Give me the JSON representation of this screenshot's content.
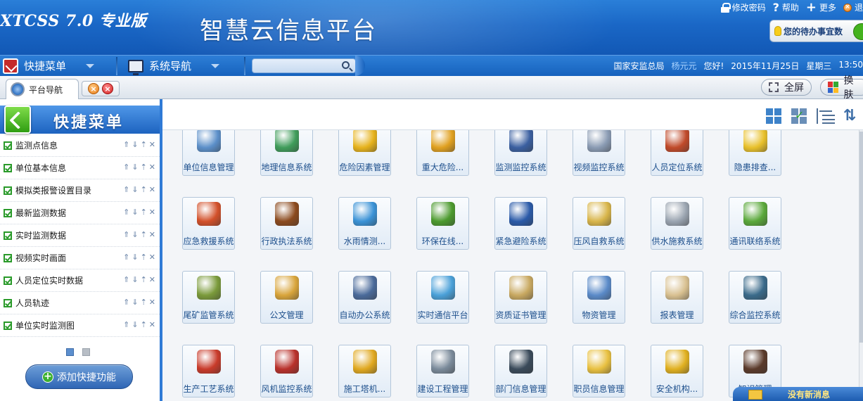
{
  "header": {
    "app_title": "XTCSS 7.0 专业版",
    "platform_title": "智慧云信息平台",
    "links": {
      "change_password": "修改密码",
      "help": "帮助",
      "more": "更多",
      "exit": "退"
    },
    "todo": "您的待办事宜数"
  },
  "navbar": {
    "quick_menu": "快捷菜单",
    "system_nav": "系统导航",
    "search_placeholder": "",
    "org": "国家安监总局",
    "user": "杨元元",
    "greeting": "您好!",
    "date": "2015年11月25日",
    "weekday": "星期三",
    "time": "13:50"
  },
  "tabbar": {
    "active_tab": "平台导航",
    "fullscreen": "全屏",
    "skin": "换肤"
  },
  "sidebar": {
    "title": "快捷菜单",
    "items": [
      {
        "label": "监测点信息"
      },
      {
        "label": "单位基本信息"
      },
      {
        "label": "模拟类报警设置目录"
      },
      {
        "label": "最新监测数据"
      },
      {
        "label": "实时监测数据"
      },
      {
        "label": "视频实时画面"
      },
      {
        "label": "人员定位实时数据"
      },
      {
        "label": "人员轨迹"
      },
      {
        "label": "单位实时监测图"
      }
    ],
    "add_label": "添加快捷功能"
  },
  "tiles": [
    {
      "label": "单位信息管理",
      "color": "#5b8fc9"
    },
    {
      "label": "地理信息系统",
      "color": "#3f9c5a"
    },
    {
      "label": "危险因素管理",
      "color": "#e6b21c"
    },
    {
      "label": "重大危险...",
      "color": "#e0a020"
    },
    {
      "label": "监测监控系统",
      "color": "#3a5fa0"
    },
    {
      "label": "视频监控系统",
      "color": "#8a9bb3"
    },
    {
      "label": "人员定位系统",
      "color": "#c04a2a"
    },
    {
      "label": "隐患排查...",
      "color": "#e8c02a"
    },
    {
      "label": "应急救援系统",
      "color": "#d2502a"
    },
    {
      "label": "行政执法系统",
      "color": "#8b4a1e"
    },
    {
      "label": "水雨情测...",
      "color": "#3a92d6"
    },
    {
      "label": "环保在线...",
      "color": "#4c9a2e"
    },
    {
      "label": "紧急避险系统",
      "color": "#2a5aa8"
    },
    {
      "label": "压风自救系统",
      "color": "#d8b54a"
    },
    {
      "label": "供水施救系统",
      "color": "#9aa4b0"
    },
    {
      "label": "通讯联络系统",
      "color": "#5aa83a"
    },
    {
      "label": "尾矿监管系统",
      "color": "#7a9a3a"
    },
    {
      "label": "公文管理",
      "color": "#d8a43a"
    },
    {
      "label": "自动办公系统",
      "color": "#4a6a9a"
    },
    {
      "label": "实时通信平台",
      "color": "#4aa0d8"
    },
    {
      "label": "资质证书管理",
      "color": "#c8a860"
    },
    {
      "label": "物资管理",
      "color": "#5a8ac8"
    },
    {
      "label": "报表管理",
      "color": "#d8c090"
    },
    {
      "label": "综合监控系统",
      "color": "#3a6a8a"
    },
    {
      "label": "生产工艺系统",
      "color": "#c83a2a"
    },
    {
      "label": "风机监控系统",
      "color": "#b8302a"
    },
    {
      "label": "施工塔机...",
      "color": "#e0a820"
    },
    {
      "label": "建设工程管理",
      "color": "#7a8a9a"
    },
    {
      "label": "部门信息管理",
      "color": "#3a4a5a"
    },
    {
      "label": "职员信息管理",
      "color": "#e8c040"
    },
    {
      "label": "安全机构...",
      "color": "#e0b020"
    },
    {
      "label": "知识管理",
      "color": "#5a3a2a"
    }
  ],
  "message_bar": "没有新消息"
}
